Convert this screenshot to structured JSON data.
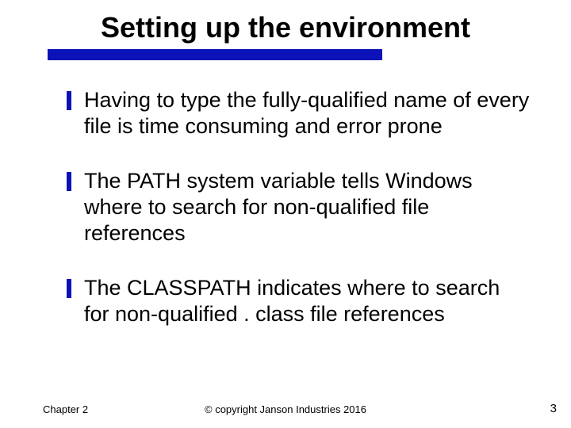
{
  "title": "Setting up the environment",
  "bullets": [
    "Having to type the fully-qualified name of every file is time consuming and error prone",
    "The PATH system variable tells Windows where to search for non-qualified file references",
    "The CLASSPATH indicates where to search for non-qualified . class file references"
  ],
  "footer": {
    "left": "Chapter 2",
    "center": "© copyright Janson Industries 2016",
    "right": "3"
  },
  "accent_color": "#0a12b8"
}
